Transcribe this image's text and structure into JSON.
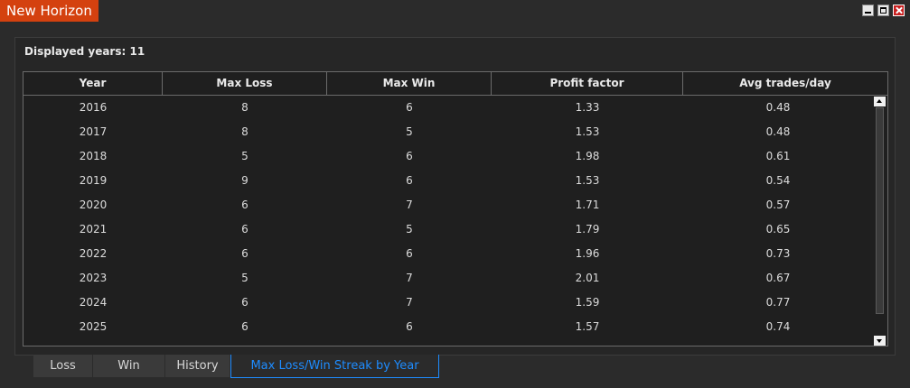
{
  "window": {
    "title": "New Horizon",
    "controls": [
      "minimize-icon",
      "maximize-icon",
      "close-icon"
    ]
  },
  "summary": {
    "displayed_years": "Displayed years: 11"
  },
  "table": {
    "columns": [
      "Year",
      "Max Loss",
      "Max Win",
      "Profit factor",
      "Avg trades/day"
    ],
    "rows": [
      [
        "2016",
        "8",
        "6",
        "1.33",
        "0.48"
      ],
      [
        "2017",
        "8",
        "5",
        "1.53",
        "0.48"
      ],
      [
        "2018",
        "5",
        "6",
        "1.98",
        "0.61"
      ],
      [
        "2019",
        "9",
        "6",
        "1.53",
        "0.54"
      ],
      [
        "2020",
        "6",
        "7",
        "1.71",
        "0.57"
      ],
      [
        "2021",
        "6",
        "5",
        "1.79",
        "0.65"
      ],
      [
        "2022",
        "6",
        "6",
        "1.96",
        "0.73"
      ],
      [
        "2023",
        "5",
        "7",
        "2.01",
        "0.67"
      ],
      [
        "2024",
        "6",
        "7",
        "1.59",
        "0.77"
      ],
      [
        "2025",
        "6",
        "6",
        "1.57",
        "0.74"
      ]
    ]
  },
  "tabs": [
    {
      "label": "Loss",
      "active": false
    },
    {
      "label": "Win",
      "active": false
    },
    {
      "label": "History",
      "active": false
    },
    {
      "label": "Max Loss/Win Streak by Year",
      "active": true
    }
  ],
  "colors": {
    "accent": "#1e8cff",
    "title_bg": "#d4410f",
    "background": "#2b2b2b"
  }
}
